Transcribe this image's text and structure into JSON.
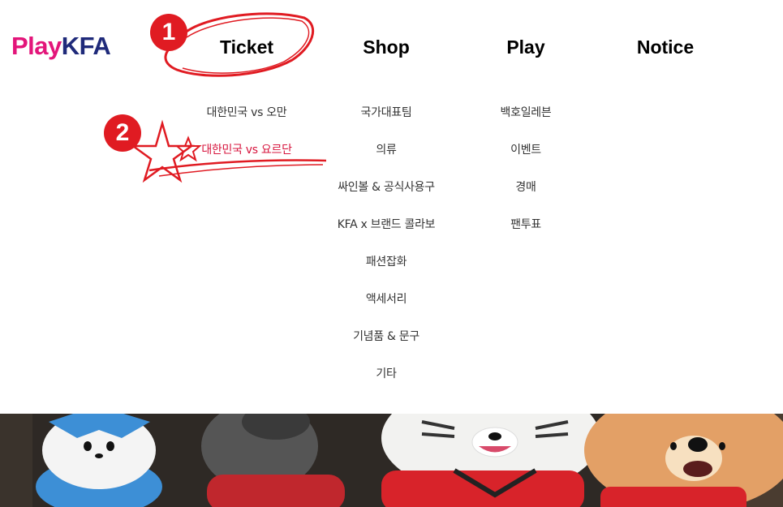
{
  "logo": {
    "play": "Play",
    "kfa": "KFA"
  },
  "nav": [
    {
      "label": "Ticket"
    },
    {
      "label": "Shop"
    },
    {
      "label": "Play"
    },
    {
      "label": "Notice"
    }
  ],
  "menu": {
    "ticket": [
      "대한민국 vs 오만",
      "대한민국 vs 요르단"
    ],
    "shop": [
      "국가대표팀",
      "의류",
      "싸인볼 & 공식사용구",
      "KFA x 브랜드 콜라보",
      "패션잡화",
      "액세서리",
      "기념품 & 문구",
      "기타"
    ],
    "play": [
      "백호일레븐",
      "이벤트",
      "경매",
      "팬투표"
    ]
  },
  "annotations": {
    "step1": "1",
    "step2": "2"
  },
  "colors": {
    "accent": "#d7143d",
    "logo_pink": "#e3157a",
    "logo_navy": "#1f2a7a",
    "annotation_red": "#e01b22"
  }
}
